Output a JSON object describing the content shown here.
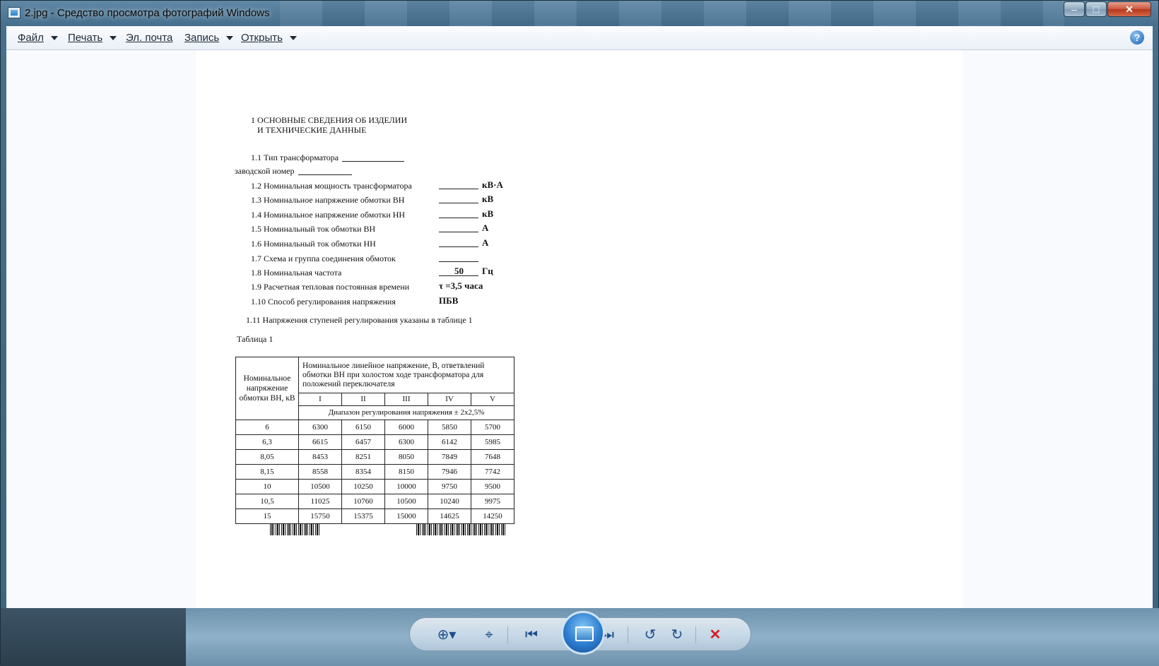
{
  "window": {
    "title": "2.jpg - Средство просмотра фотографий Windows",
    "minimize": "–",
    "maximize": "□",
    "close": "✕"
  },
  "menu": {
    "file": "Файл",
    "print": "Печать",
    "email": "Эл. почта",
    "burn": "Запись",
    "open": "Открыть",
    "help_icon": "help-icon"
  },
  "document": {
    "heading_1": "1 ОСНОВНЫЕ СВЕДЕНИЯ ОБ ИЗДЕЛИИ",
    "heading_2": "И ТЕХНИЧЕСКИЕ ДАННЫЕ",
    "fields": [
      {
        "label": "1.1 Тип трансформатора",
        "value": "",
        "unit": ""
      },
      {
        "label": "заводской номер",
        "value": "",
        "unit": ""
      },
      {
        "label": "1.2 Номинальная мощность трансформатора",
        "value": "",
        "unit": "кВ·А"
      },
      {
        "label": "1.3 Номинальное напряжение обмотки ВН",
        "value": "",
        "unit": "кВ"
      },
      {
        "label": "1.4 Номинальное напряжение обмотки НН",
        "value": "",
        "unit": "кВ"
      },
      {
        "label": "1.5 Номинальный ток обмотки ВН",
        "value": "",
        "unit": "А"
      },
      {
        "label": "1.6 Номинальный ток обмотки НН",
        "value": "",
        "unit": "А"
      },
      {
        "label": "1.7 Схема и группа соединения обмоток",
        "value": "",
        "unit": ""
      },
      {
        "label": "1.8 Номинальная частота",
        "value": "50",
        "unit": "Гц"
      },
      {
        "label": "1.9 Расчетная тепловая постоянная времени",
        "value": "τ =3,5 часа",
        "unit": ""
      },
      {
        "label": "1.10 Способ регулирования напряжения",
        "value": "ПБВ",
        "unit": ""
      }
    ],
    "note": "1.11 Напряжения ступеней регулирования указаны в таблице 1",
    "table_caption": "Таблица 1",
    "table": {
      "left_header": "Номинальное напряжение обмотки ВН, кВ",
      "top_header": "Номинальное линейное напряжение, В, ответвлений обмотки ВН  при холостом ходе трансформатора для положений переключателя",
      "positions": [
        "I",
        "II",
        "III",
        "IV",
        "V"
      ],
      "range": "Диапазон регулирования напряжения  ± 2х2,5%",
      "rows": [
        {
          "nominal": "6",
          "values": [
            "6300",
            "6150",
            "6000",
            "5850",
            "5700"
          ]
        },
        {
          "nominal": "6,3",
          "values": [
            "6615",
            "6457",
            "6300",
            "6142",
            "5985"
          ]
        },
        {
          "nominal": "8,05",
          "values": [
            "8453",
            "8251",
            "8050",
            "7849",
            "7648"
          ]
        },
        {
          "nominal": "8,15",
          "values": [
            "8558",
            "8354",
            "8150",
            "7946",
            "7742"
          ]
        },
        {
          "nominal": "10",
          "values": [
            "10500",
            "10250",
            "10000",
            "9750",
            "9500"
          ]
        },
        {
          "nominal": "10,5",
          "values": [
            "11025",
            "10760",
            "10500",
            "10240",
            "9975"
          ]
        },
        {
          "nominal": "15",
          "values": [
            "15750",
            "15375",
            "15000",
            "14625",
            "14250"
          ]
        }
      ]
    }
  },
  "toolbar": {
    "zoom_icon": "zoom-icon",
    "fit_icon": "actual-size-icon",
    "prev_icon": "previous-icon",
    "slideshow_icon": "slideshow-icon",
    "next_icon": "next-icon",
    "rotate_left_icon": "rotate-ccw-icon",
    "rotate_right_icon": "rotate-cw-icon",
    "delete_icon": "delete-icon",
    "delete_color": "#d21f1f"
  }
}
